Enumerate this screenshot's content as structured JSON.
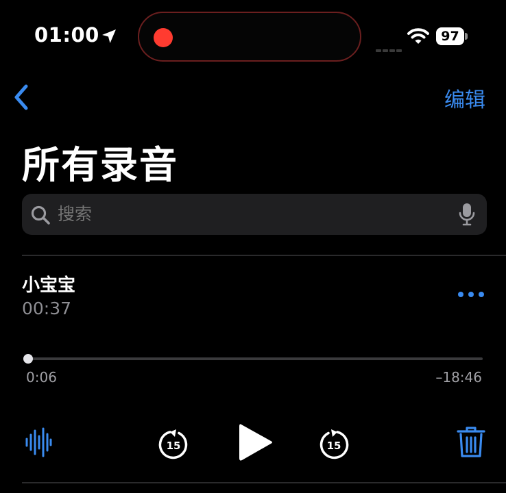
{
  "status_bar": {
    "time": "01:00",
    "battery": "97",
    "icons": [
      "location-arrow-icon",
      "recording-dot-icon",
      "cellular-signal-icon",
      "wifi-icon",
      "battery-icon"
    ]
  },
  "nav": {
    "back_icon": "chevron-left-icon",
    "edit_label": "编辑"
  },
  "page_title": "所有录音",
  "search": {
    "placeholder": "搜索",
    "value": "",
    "icons": [
      "search-icon",
      "microphone-icon"
    ]
  },
  "recording": {
    "title": "小宝宝",
    "duration": "00:37",
    "elapsed": "0:06",
    "remaining": "–18:46",
    "progress": 0.005,
    "more_icon": "ellipsis-icon"
  },
  "controls": {
    "skip_back_seconds": "15",
    "skip_forward_seconds": "15",
    "icons": [
      "waveform-icon",
      "skip-back-15-icon",
      "play-icon",
      "skip-forward-15-icon",
      "trash-icon"
    ]
  },
  "colors": {
    "accent": "#3a8bf0",
    "record": "#ff3b30",
    "background": "#000000",
    "secondary_text": "#8e8e93"
  }
}
